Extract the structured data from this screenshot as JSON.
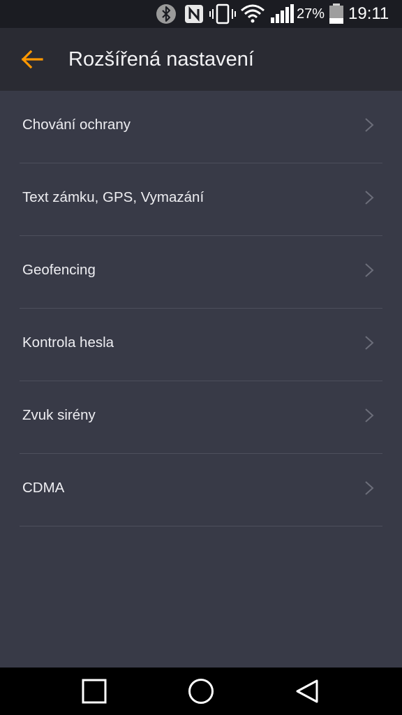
{
  "status_bar": {
    "battery_percent": "27%",
    "time": "19:11",
    "icons": [
      "bluetooth-icon",
      "nfc-icon",
      "vibrate-icon",
      "wifi-icon",
      "signal-icon",
      "battery-icon"
    ],
    "battery_level": 0.27
  },
  "app_bar": {
    "title": "Rozšířená nastavení",
    "back_icon": "arrow-back-icon",
    "accent_color": "#ff9800"
  },
  "settings": {
    "items": [
      {
        "label": "Chování ochrany"
      },
      {
        "label": "Text zámku, GPS, Vymazání"
      },
      {
        "label": "Geofencing"
      },
      {
        "label": "Kontrola hesla"
      },
      {
        "label": "Zvuk sirény"
      },
      {
        "label": "CDMA"
      }
    ]
  },
  "nav_bar": {
    "icons": [
      "recents-square-icon",
      "home-circle-icon",
      "back-triangle-icon"
    ]
  }
}
